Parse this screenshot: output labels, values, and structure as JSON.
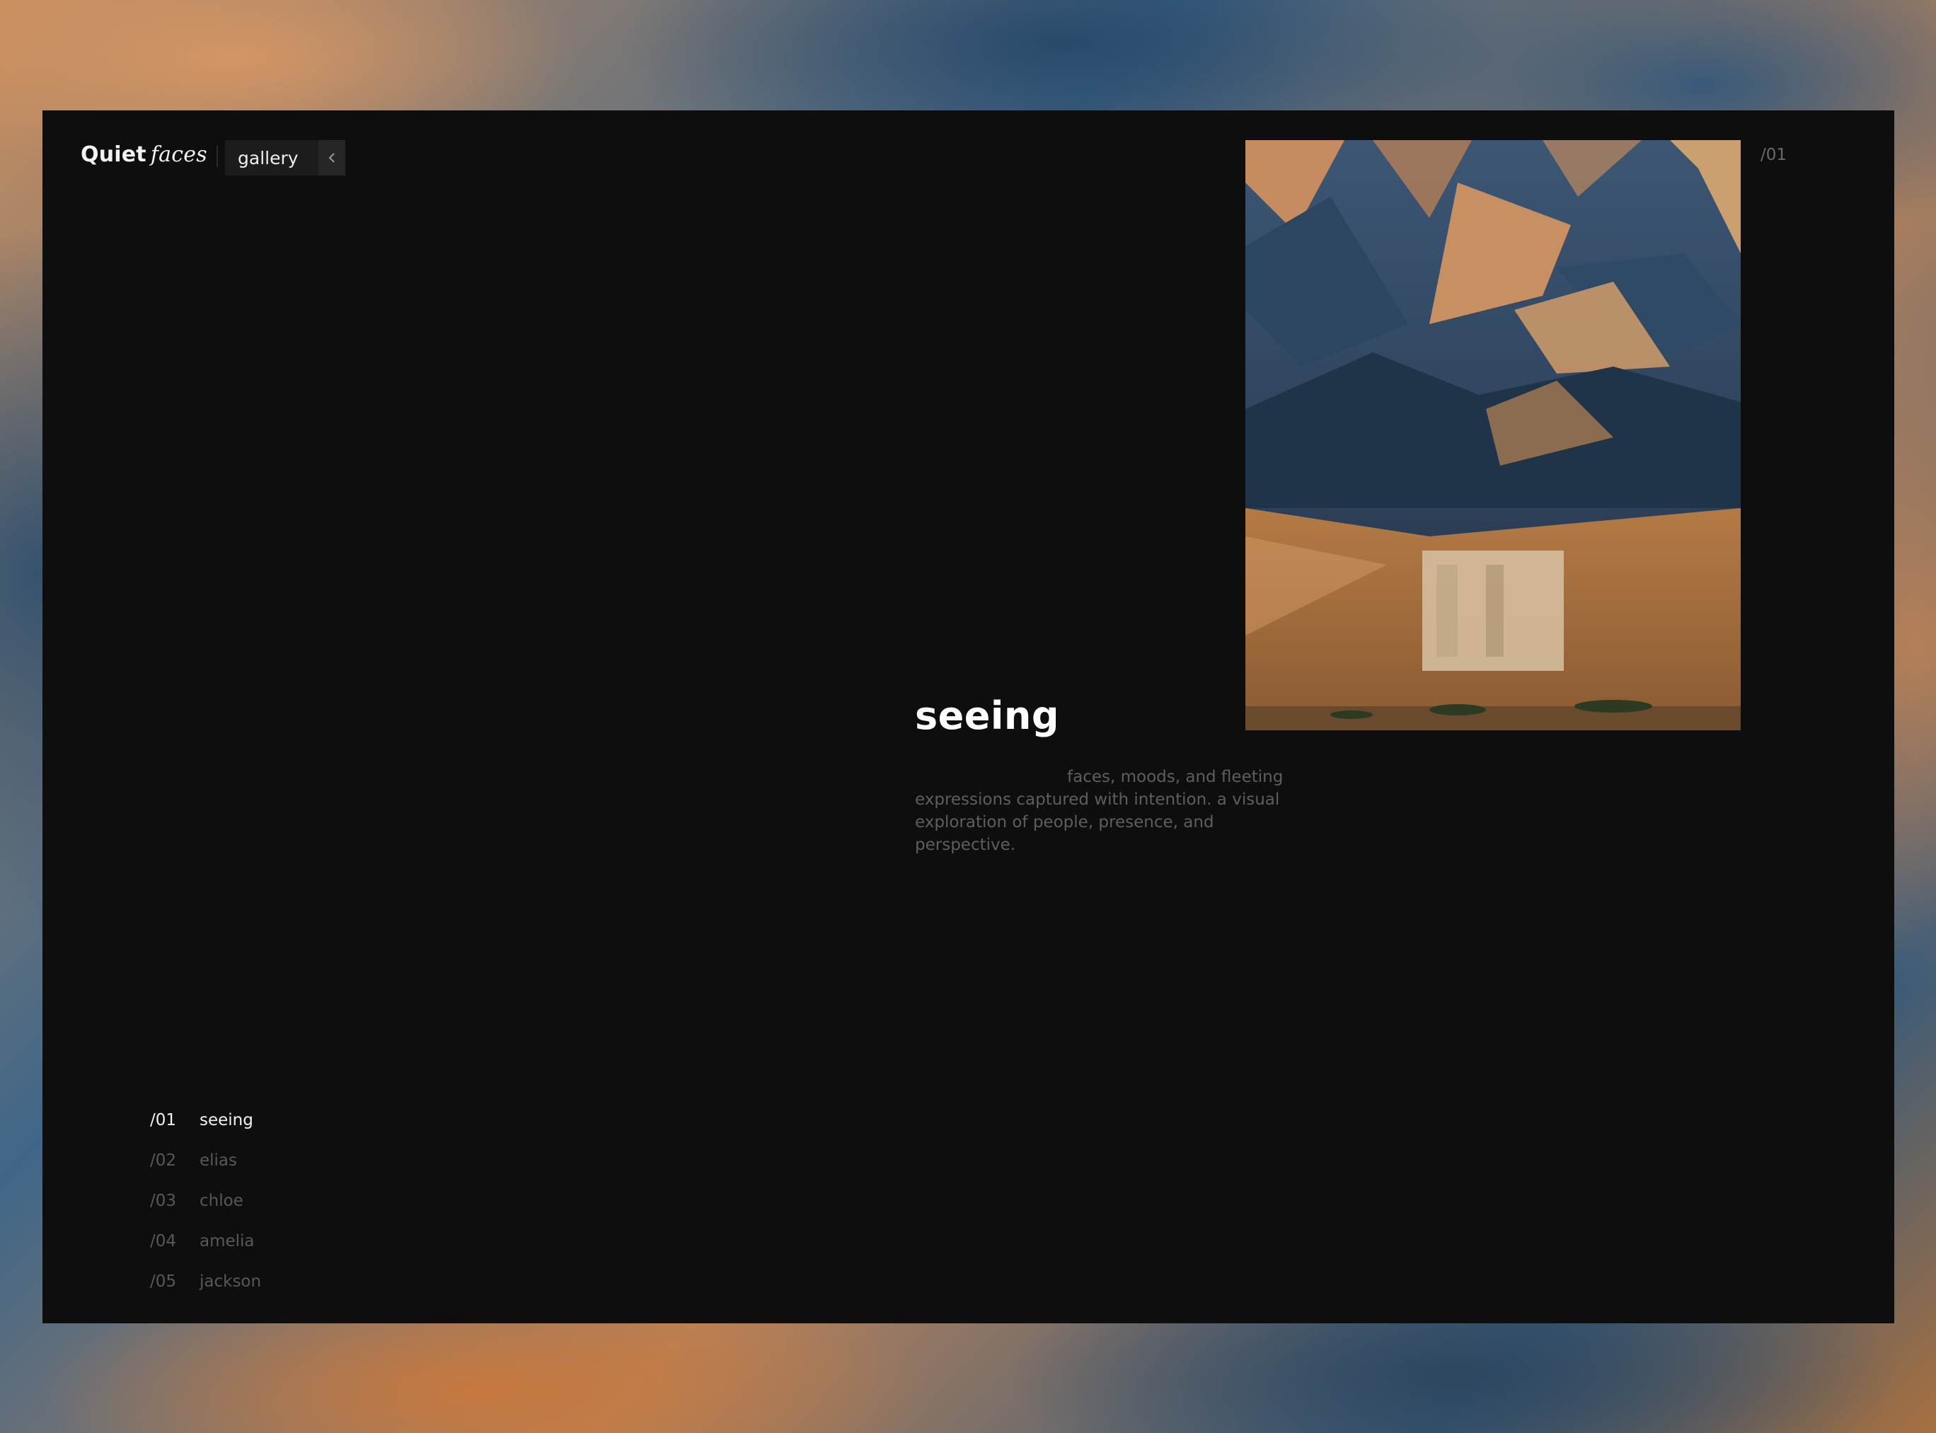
{
  "brand": {
    "name_strong": "Quiet",
    "name_italic": "faces"
  },
  "menu": {
    "label": "gallery",
    "toggle_icon": "chevron-left-icon"
  },
  "slide": {
    "index": "/01",
    "title": "seeing",
    "description": "faces, moods, and fleeting expressions captured with intention. a visual exploration of people, presence, and perspective."
  },
  "nav": {
    "items": [
      {
        "num": "/01",
        "label": "seeing",
        "active": true
      },
      {
        "num": "/02",
        "label": "elias",
        "active": false
      },
      {
        "num": "/03",
        "label": "chloe",
        "active": false
      },
      {
        "num": "/04",
        "label": "amelia",
        "active": false
      },
      {
        "num": "/05",
        "label": "jackson",
        "active": false
      }
    ]
  },
  "colors": {
    "panel": "#0e0e0f",
    "text_primary": "#f2f2f2",
    "text_muted": "#5e5e5e",
    "button_bg": "#1c1c1d"
  }
}
